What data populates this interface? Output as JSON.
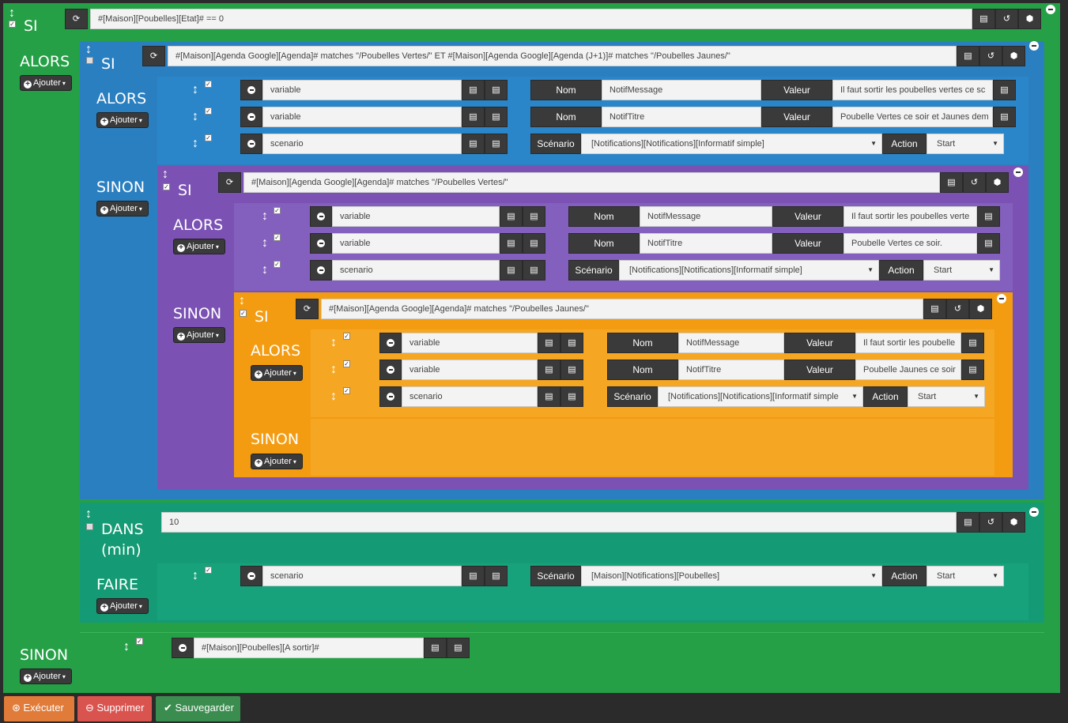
{
  "colors": {
    "green": "#25a046",
    "blue": "#2a7fc0",
    "purple": "#7b52b4",
    "orange": "#f39c12",
    "teal": "#149a74",
    "dark": "#3a3a3a"
  },
  "root": {
    "si_label": "SI",
    "condition": "#[Maison][Poubelles][Etat]# == 0",
    "alors_label": "ALORS",
    "sinon_label": "SINON",
    "add_label": "Ajouter"
  },
  "b1": {
    "si_label": "SI",
    "condition": "#[Maison][Agenda Google][Agenda]# matches \"/Poubelles Vertes/\" ET #[Maison][Agenda Google][Agenda (J+1)]# matches \"/Poubelles Jaunes/\"",
    "alors_label": "ALORS",
    "sinon_label": "SINON",
    "actions": [
      {
        "cmd": "variable",
        "k1": "Nom",
        "v1": "NotifMessage",
        "k2": "Valeur",
        "v2": "Il faut sortir les poubelles vertes ce sc"
      },
      {
        "cmd": "variable",
        "k1": "Nom",
        "v1": "NotifTitre",
        "k2": "Valeur",
        "v2": "Poubelle Vertes ce soir et Jaunes dem"
      },
      {
        "cmd": "scenario",
        "k1": "Scénario",
        "v1": "[Notifications][Notifications][Informatif simple]",
        "k2": "Action",
        "v2": "Start"
      }
    ]
  },
  "b2": {
    "si_label": "SI",
    "condition": "#[Maison][Agenda Google][Agenda]# matches \"/Poubelles Vertes/\"",
    "alors_label": "ALORS",
    "sinon_label": "SINON",
    "actions": [
      {
        "cmd": "variable",
        "k1": "Nom",
        "v1": "NotifMessage",
        "k2": "Valeur",
        "v2": "Il faut sortir les poubelles verte"
      },
      {
        "cmd": "variable",
        "k1": "Nom",
        "v1": "NotifTitre",
        "k2": "Valeur",
        "v2": "Poubelle Vertes ce soir."
      },
      {
        "cmd": "scenario",
        "k1": "Scénario",
        "v1": "[Notifications][Notifications][Informatif simple]",
        "k2": "Action",
        "v2": "Start"
      }
    ]
  },
  "b3": {
    "si_label": "SI",
    "condition": "#[Maison][Agenda Google][Agenda]# matches \"/Poubelles Jaunes/\"",
    "alors_label": "ALORS",
    "sinon_label": "SINON",
    "actions": [
      {
        "cmd": "variable",
        "k1": "Nom",
        "v1": "NotifMessage",
        "k2": "Valeur",
        "v2": "Il faut sortir les poubelle"
      },
      {
        "cmd": "variable",
        "k1": "Nom",
        "v1": "NotifTitre",
        "k2": "Valeur",
        "v2": "Poubelle Jaunes ce soir"
      },
      {
        "cmd": "scenario",
        "k1": "Scénario",
        "v1": "[Notifications][Notifications][Informatif simple",
        "k2": "Action",
        "v2": "Start"
      }
    ]
  },
  "dans": {
    "label1": "DANS",
    "label2": "(min)",
    "value": "10",
    "faire_label": "FAIRE",
    "action": {
      "cmd": "scenario",
      "k1": "Scénario",
      "v1": "[Maison][Notifications][Poubelles]",
      "k2": "Action",
      "v2": "Start"
    }
  },
  "sinon_root": {
    "cmd": "#[Maison][Poubelles][A sortir]#"
  },
  "footer": {
    "execute": "Exécuter",
    "delete": "Supprimer",
    "save": "Sauvegarder"
  }
}
